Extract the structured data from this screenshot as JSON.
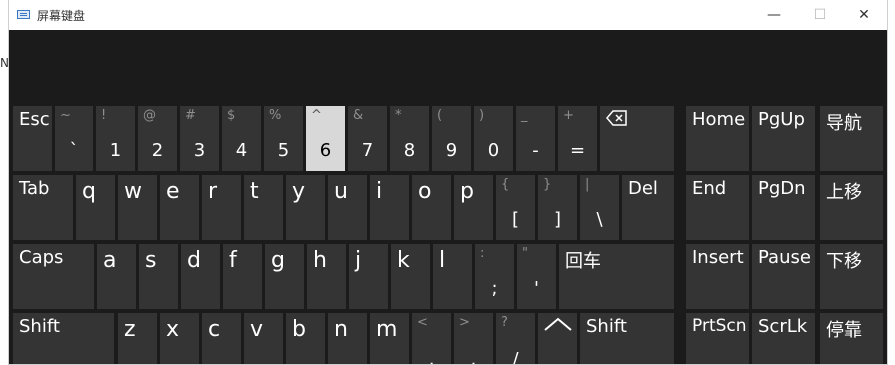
{
  "window": {
    "title": "屏幕键盘",
    "minimize": "—",
    "maximize": "☐",
    "close": "✕"
  },
  "outer": {
    "left_glyph": "N"
  },
  "keys": {
    "esc": "Esc",
    "tilde_top": "~",
    "tilde_main": "`",
    "k1_top": "!",
    "k1_main": "1",
    "k2_top": "@",
    "k2_main": "2",
    "k3_top": "#",
    "k3_main": "3",
    "k4_top": "$",
    "k4_main": "4",
    "k5_top": "%",
    "k5_main": "5",
    "k6_top": "^",
    "k6_main": "6",
    "k7_top": "&",
    "k7_main": "7",
    "k8_top": "*",
    "k8_main": "8",
    "k9_top": "(",
    "k9_main": "9",
    "k0_top": ")",
    "k0_main": "0",
    "minus_top": "_",
    "minus_main": "-",
    "equal_top": "+",
    "equal_main": "=",
    "backspace_icon": "backspace-icon",
    "home": "Home",
    "pgup": "PgUp",
    "nav": "导航",
    "tab": "Tab",
    "q": "q",
    "w": "w",
    "e": "e",
    "r": "r",
    "t": "t",
    "y": "y",
    "u": "u",
    "i": "i",
    "o": "o",
    "p": "p",
    "lbrace_top": "{",
    "lbrace_main": "[",
    "rbrace_top": "}",
    "rbrace_main": "]",
    "pipe_top": "|",
    "pipe_main": "\\",
    "del": "Del",
    "end": "End",
    "pgdn": "PgDn",
    "moveup": "上移",
    "caps": "Caps",
    "a": "a",
    "s": "s",
    "d": "d",
    "f": "f",
    "g": "g",
    "h": "h",
    "j": "j",
    "k": "k",
    "l": "l",
    "colon_top": ":",
    "colon_main": ";",
    "quote_top": "\"",
    "quote_main": "'",
    "enter": "回车",
    "insert": "Insert",
    "pause": "Pause",
    "movedown": "下移",
    "shift_left": "Shift",
    "z": "z",
    "x": "x",
    "c": "c",
    "v": "v",
    "b": "b",
    "n": "n",
    "m": "m",
    "lt_top": "<",
    "lt_main": ",",
    "gt_top": ">",
    "gt_main": ".",
    "q_top": "?",
    "q_main": "/",
    "up_icon": "up-arrow-icon",
    "shift_right": "Shift",
    "prtscn": "PrtScn",
    "scrlk": "ScrLk",
    "dock": "停靠"
  },
  "colors": {
    "key_bg": "#343434",
    "key_highlight": "#d8d8d8",
    "background": "#1b1b1b"
  }
}
